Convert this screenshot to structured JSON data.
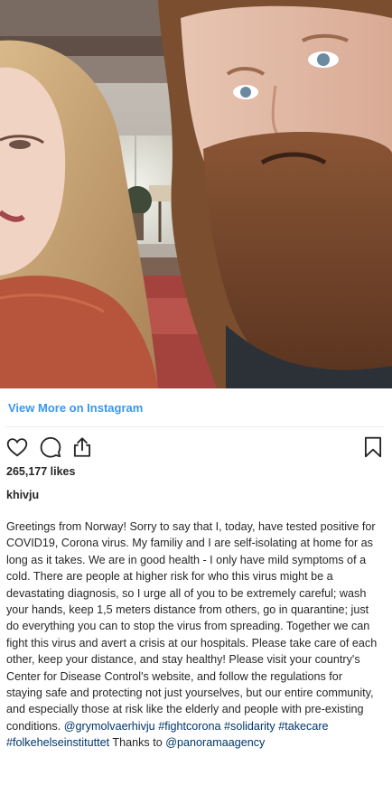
{
  "embed": {
    "view_more_label": "View More on Instagram",
    "likes": "265,177 likes",
    "username": "khivju",
    "caption": {
      "text": "Greetings from Norway! Sorry to say that I, today, have tested positive for COVID19, Corona virus. My familiy and I are self-isolating at home for as long as it takes. We are in good health - I only have mild symptoms of a cold. There are people at higher risk for who this virus might be a devastating diagnosis, so I urge all of you to be extremely careful; wash your hands, keep 1,5 meters distance from others, go in quarantine; just do everything you can to stop the virus from spreading. Together we can fight this virus and avert a crisis at our hospitals. Please take care of each other, keep your distance, and stay healthy! Please visit your country's Center for Disease Control's website, and follow the regulations for staying safe and protecting not just yourselves, but our entire community, and especially those at risk like the elderly and people with pre-existing conditions.",
      "mention_1": "@grymolvaerhivju",
      "hashtag_1": "#fightcorona",
      "hashtag_2": "#solidarity",
      "hashtag_3": "#takecare",
      "hashtag_4": "#folkehelseinstituttet",
      "thanks": "Thanks to",
      "mention_2": "@panoramaagency"
    },
    "icons": [
      "heart-icon",
      "comment-icon",
      "share-icon",
      "bookmark-icon"
    ],
    "colors": {
      "link_blue": "#3897f0",
      "tag_blue": "#003569",
      "text": "#262626",
      "divider": "#efefef"
    }
  }
}
